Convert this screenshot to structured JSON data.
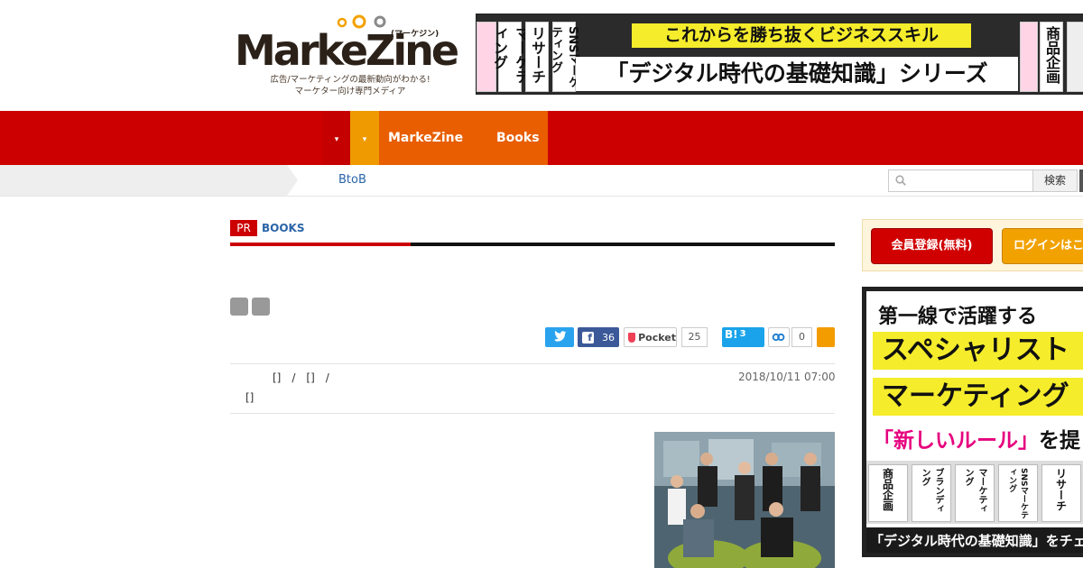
{
  "header": {
    "logo_text": "MarkeZine",
    "logo_kana": "(マーケジン)",
    "tagline_1": "広告/マーケティングの最新動向がわかる!",
    "tagline_2": "マーケター向け専門メディア"
  },
  "top_banner": {
    "headline": "これからを勝ち抜くビジネススキル",
    "series": "「デジタル時代の基礎知識」シリーズ",
    "books": [
      "マーケティング",
      "リサーチ",
      "SNSマーケティング",
      "商品企画"
    ]
  },
  "nav": {
    "items": [
      "MarkeZine",
      "Books"
    ],
    "dropdown_glyph": "▾"
  },
  "subnav": {
    "link": "BtoB",
    "search_placeholder": "",
    "search_button": "検索"
  },
  "article": {
    "pr_badge": "PR",
    "section_label": "BOOKS",
    "social": {
      "facebook_count": "36",
      "pocket_label": "Pocket",
      "pocket_count": "25",
      "hatena_label": "B!",
      "hatena_count": "3",
      "link_count": "0"
    },
    "author_line_1": "[]　/　[]　/",
    "author_line_2": "[]",
    "date": "2018/10/11 07:00"
  },
  "sidebar": {
    "register_button": "会員登録(無料)",
    "login_button": "ログインはこ",
    "ad": {
      "line1": "第一線で活躍する",
      "line2": "スペシャリスト",
      "line3": "マーケティング",
      "line4_pink": "「新しいルール」",
      "line4_rest": "を提",
      "books": [
        "商品企画",
        "ブランディング",
        "マーケティング",
        "SNSマーケティング",
        "リサーチ"
      ],
      "footer": "「デジタル時代の基礎知識」をチェ"
    }
  },
  "colors": {
    "brand_red": "#cc0000",
    "nav_orange": "#e85e00",
    "accent_yellow": "#f5ec2c",
    "link_blue": "#2a64a8"
  }
}
